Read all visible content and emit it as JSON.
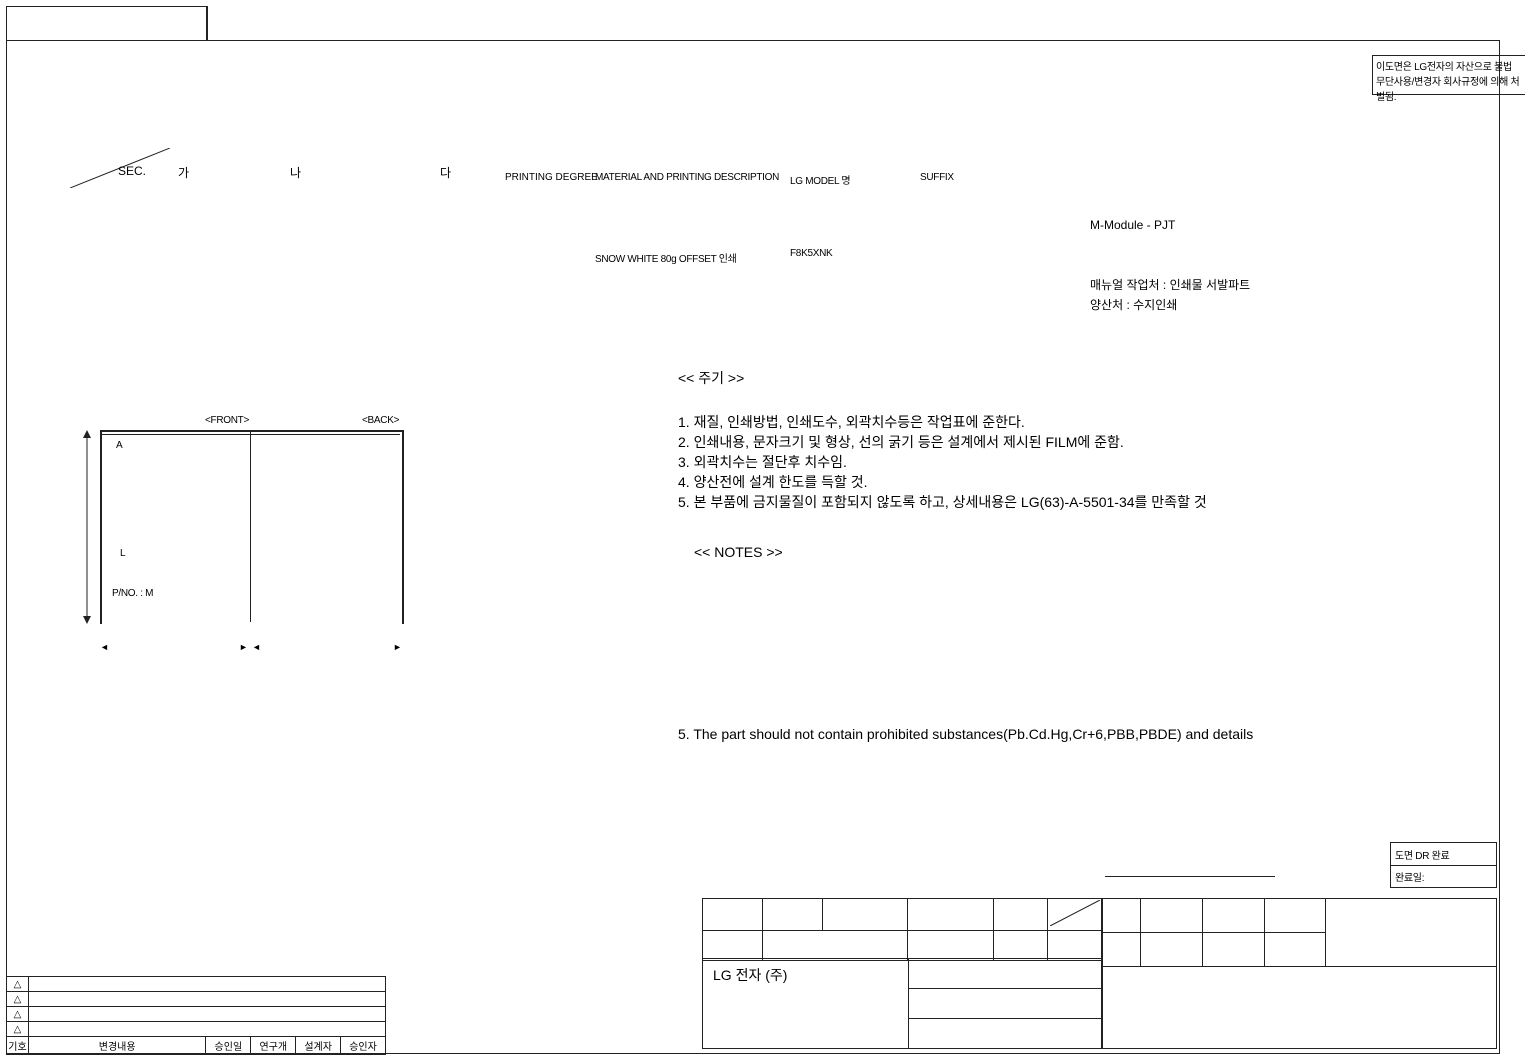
{
  "confidential": {
    "line1": "이도면은 LG전자의 자산으로 불법",
    "line2": "무단사용/변경자 회사규정에 의해 처벌됨."
  },
  "header": {
    "sec": "SEC.",
    "col_ga": "가",
    "col_na": "나",
    "col_da": "다",
    "printing_degree": "PRINTING DEGREE",
    "material_desc": "MATERIAL AND PRINTING DESCRIPTION",
    "lg_model": "LG MODEL 명",
    "suffix": "SUFFIX",
    "material_value": "SNOW WHITE 80g OFFSET 인쇄",
    "model_value": "F8K5XNK",
    "module_label": "M-Module - PJT",
    "manual_line": "매뉴얼 작업처 : 인쇄물 서발파트",
    "prod_line": "양산처 : 수지인쇄"
  },
  "left_fig": {
    "front": "<FRONT>",
    "back": "<BACK>",
    "a_label": "A",
    "l_label": "L",
    "pn_label": "P/NO. : M"
  },
  "notes_ko": {
    "title": "<< 주기 >>",
    "n1": "1. 재질, 인쇄방법, 인쇄도수, 외곽치수등은 작업표에 준한다.",
    "n2": "2. 인쇄내용, 문자크기 및 형상, 선의 굵기 등은 설계에서 제시된 FILM에 준함.",
    "n3": "3. 외곽치수는 절단후 치수임.",
    "n4": "4. 양산전에 설계 한도를 득할 것.",
    "n5": "5. 본 부품에 금지물질이 포함되지 않도록 하고, 상세내용은 LG(63)-A-5501-34를 만족할 것"
  },
  "notes_en": {
    "title": "<< NOTES >>",
    "n5": "5. The part should not contain prohibited substances(Pb.Cd.Hg,Cr+6,PBB,PBDE) and details"
  },
  "dr_box": {
    "line1": "도면 DR 완료",
    "line2": "완료일:"
  },
  "title_block": {
    "company": "LG 전자    (주)"
  },
  "rev_table": {
    "hdr_sym": "기호",
    "hdr_desc": "변경내용",
    "hdr_date": "승인일",
    "hdr_dept": "연구개",
    "hdr_des": "설계자",
    "hdr_app": "승인자"
  }
}
